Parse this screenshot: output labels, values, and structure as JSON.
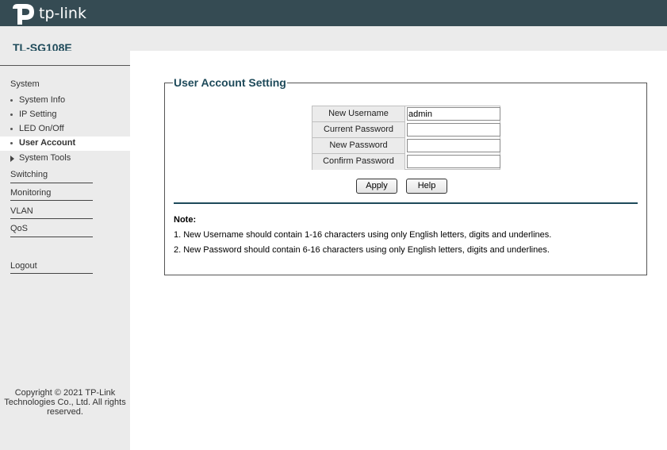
{
  "header": {
    "brand": "tp-link",
    "model": "TL-SG108E"
  },
  "sidebar": {
    "system_label": "System",
    "system_items": [
      {
        "label": "System Info"
      },
      {
        "label": "IP Setting"
      },
      {
        "label": "LED On/Off"
      },
      {
        "label": "User Account"
      },
      {
        "label": "System Tools"
      }
    ],
    "sections": [
      {
        "label": "Switching"
      },
      {
        "label": "Monitoring"
      },
      {
        "label": "VLAN"
      },
      {
        "label": "QoS"
      }
    ],
    "logout_label": "Logout",
    "copyright": "Copyright © 2021 TP-Link Technologies Co., Ltd. All rights reserved."
  },
  "main": {
    "title": "User Account Setting",
    "fields": [
      {
        "label": "New Username",
        "value": "admin"
      },
      {
        "label": "Current Password",
        "value": ""
      },
      {
        "label": "New Password",
        "value": ""
      },
      {
        "label": "Confirm Password",
        "value": ""
      }
    ],
    "apply_label": "Apply",
    "help_label": "Help",
    "note_title": "Note:",
    "notes": [
      "1. New Username should contain 1-16 characters using only English letters, digits and underlines.",
      "2. New Password should contain 6-16 characters using only English letters, digits and underlines."
    ]
  },
  "colors": {
    "topbar": "#354b53",
    "accent": "#1e4a5a",
    "sidebar_bg": "#ebebeb"
  }
}
